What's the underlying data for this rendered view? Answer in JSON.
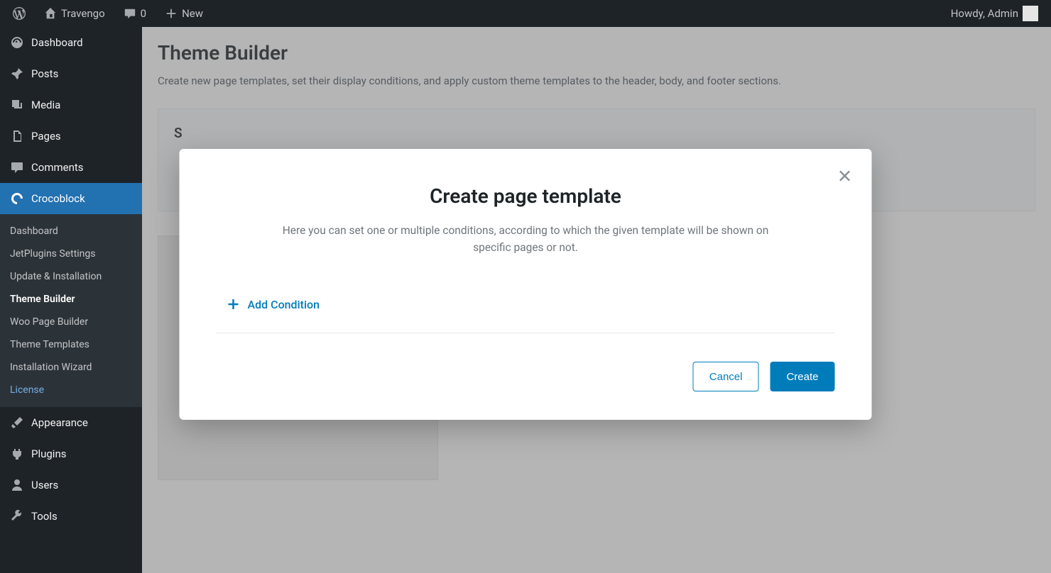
{
  "admin_bar": {
    "site_name": "Travengo",
    "comments_count": "0",
    "new_label": "New",
    "howdy": "Howdy, Admin"
  },
  "sidebar": {
    "items": [
      {
        "label": "Dashboard",
        "icon": "dashboard"
      },
      {
        "label": "Posts",
        "icon": "pin"
      },
      {
        "label": "Media",
        "icon": "media"
      },
      {
        "label": "Pages",
        "icon": "pages"
      },
      {
        "label": "Comments",
        "icon": "comment"
      },
      {
        "label": "Crocoblock",
        "icon": "croco"
      },
      {
        "label": "Appearance",
        "icon": "brush"
      },
      {
        "label": "Plugins",
        "icon": "plug"
      },
      {
        "label": "Users",
        "icon": "user"
      },
      {
        "label": "Tools",
        "icon": "wrench"
      }
    ],
    "sub": [
      {
        "label": "Dashboard"
      },
      {
        "label": "JetPlugins Settings"
      },
      {
        "label": "Update & Installation"
      },
      {
        "label": "Theme Builder"
      },
      {
        "label": "Woo Page Builder"
      },
      {
        "label": "Theme Templates"
      },
      {
        "label": "Installation Wizard"
      },
      {
        "label": "License"
      }
    ]
  },
  "page": {
    "title": "Theme Builder",
    "description": "Create new page templates, set their display conditions, and apply custom theme templates to the header, body, and footer sections.",
    "panel_leading_text": "S"
  },
  "modal": {
    "title": "Create page template",
    "description": "Here you can set one or multiple conditions, according to which the given template will be shown on specific pages or not.",
    "add_condition": "Add Condition",
    "cancel": "Cancel",
    "create": "Create"
  }
}
